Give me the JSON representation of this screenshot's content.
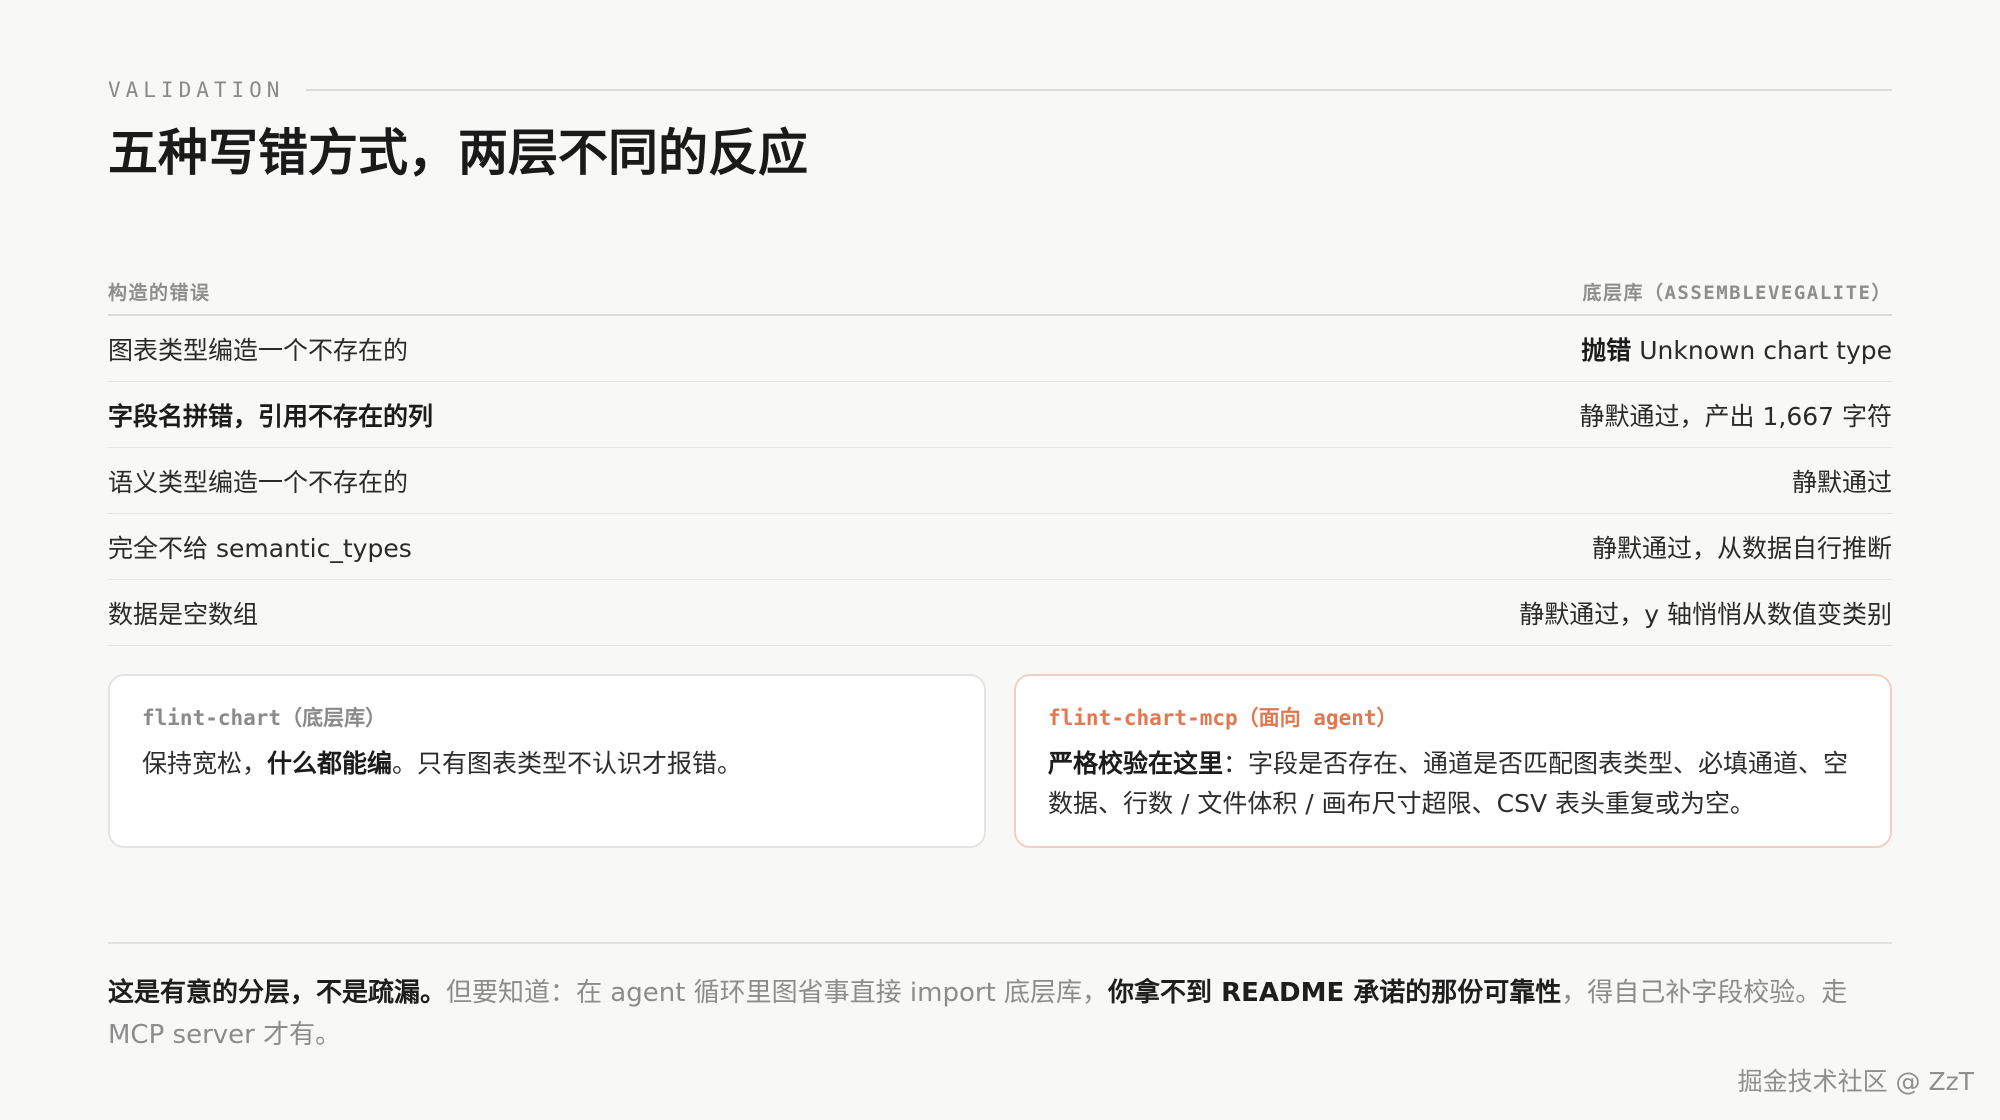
{
  "header": {
    "eyebrow": "VALIDATION",
    "title": "五种写错方式，两层不同的反应"
  },
  "table": {
    "columns": [
      "构造的错误",
      "底层库（ASSEMBLEVEGALITE）"
    ],
    "rows": [
      {
        "error": "图表类型编造一个不存在的",
        "result_bold": "抛错",
        "result_rest": " Unknown chart type"
      },
      {
        "error": "字段名拼错，引用不存在的列",
        "result_bold": "",
        "result_rest": "静默通过，产出 1,667 字符"
      },
      {
        "error": "语义类型编造一个不存在的",
        "result_bold": "",
        "result_rest": "静默通过"
      },
      {
        "error": "完全不给 semantic_types",
        "result_bold": "",
        "result_rest": "静默通过，从数据自行推断"
      },
      {
        "error": "数据是空数组",
        "result_bold": "",
        "result_rest": "静默通过，y 轴悄悄从数值变类别"
      }
    ]
  },
  "cards": {
    "left": {
      "label": "flint-chart（底层库）",
      "text_1": "保持宽松，",
      "text_bold": "什么都能编",
      "text_2": "。只有图表类型不认识才报错。"
    },
    "right": {
      "label": "flint-chart-mcp（面向 agent）",
      "text_bold": "严格校验在这里",
      "text_rest": "：字段是否存在、通道是否匹配图表类型、必填通道、空数据、行数 / 文件体积 / 画布尺寸超限、CSV 表头重复或为空。"
    }
  },
  "note": {
    "bold_1": "这是有意的分层，不是疏漏。",
    "text_1": "但要知道：在 agent 循环里图省事直接 import 底层库，",
    "bold_2": "你拿不到 README 承诺的那份可靠性",
    "text_2": "，得自己补字段校验。走 MCP server 才有。"
  },
  "watermark": "掘金技术社区 @ ZzT"
}
